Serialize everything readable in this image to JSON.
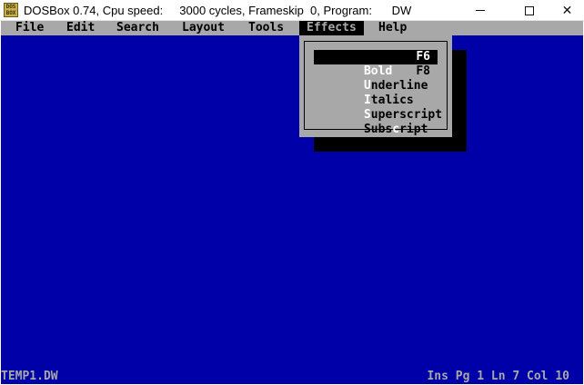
{
  "window": {
    "icon_text": "DOS BOX",
    "title": "DOSBox 0.74, Cpu speed:     3000 cycles, Frameskip  0, Program:      DW",
    "controls": {
      "minimize": "minimize",
      "maximize": "maximize",
      "close": "✕"
    }
  },
  "menubar": {
    "items": [
      "File",
      "Edit",
      "Search",
      "Layout",
      "Tools",
      "Effects",
      "Help"
    ],
    "active": "Effects"
  },
  "effects_menu": {
    "items": [
      {
        "hotkey": "B",
        "rest": "old",
        "shortcut": "F6",
        "selected": true
      },
      {
        "hotkey": "U",
        "rest": "nderline",
        "shortcut": "F8",
        "selected": false
      },
      {
        "hotkey": "I",
        "rest": "talics",
        "shortcut": "",
        "selected": false
      },
      {
        "hotkey": "S",
        "rest": "uperscript",
        "shortcut": "",
        "selected": false
      },
      {
        "pre": "Subs",
        "hotkey": "c",
        "rest": "ript",
        "shortcut": "",
        "selected": false
      }
    ]
  },
  "status": {
    "filename": "TEMP1.DW",
    "position": "Ins Pg 1 Ln 7 Col 10"
  },
  "colors": {
    "dos_blue": "#0000a8",
    "dos_gray": "#a8a8a8",
    "dos_black": "#000000",
    "dos_white": "#ffffff"
  }
}
